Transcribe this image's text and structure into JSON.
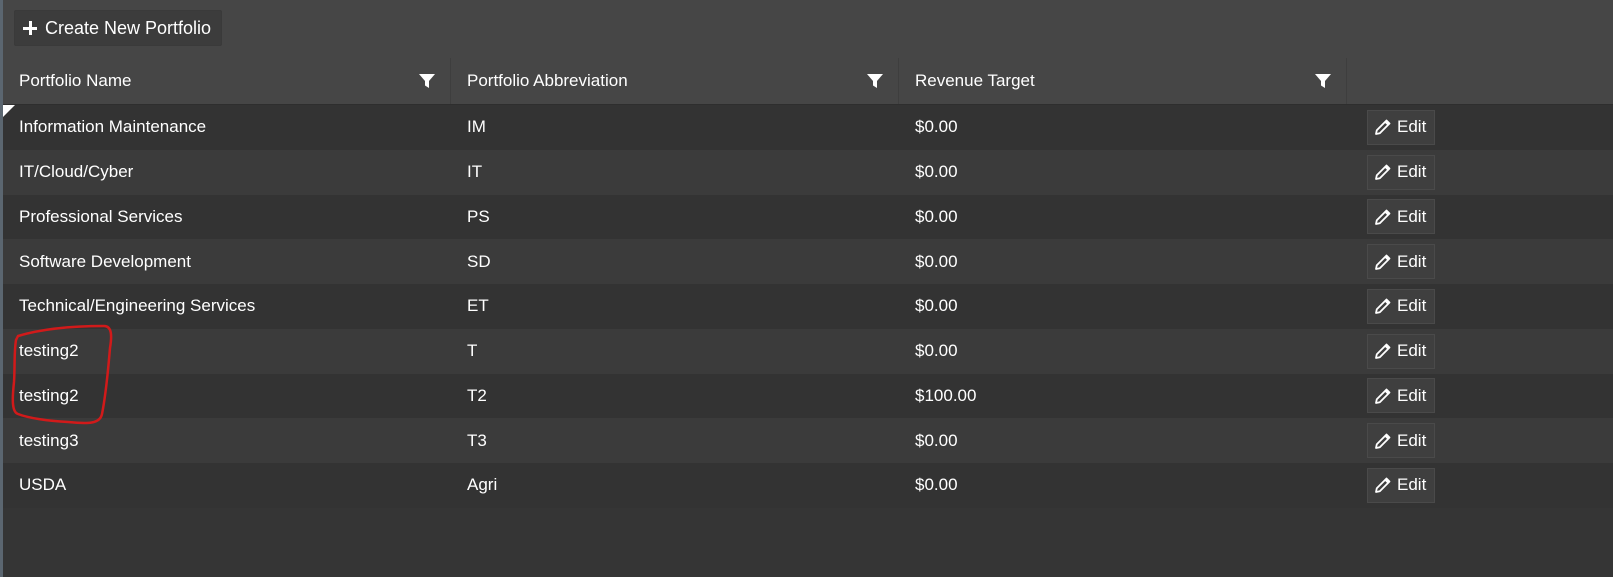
{
  "toolbar": {
    "create_label": "Create New Portfolio"
  },
  "columns": [
    {
      "label": "Portfolio Name",
      "filterable": true
    },
    {
      "label": "Portfolio Abbreviation",
      "filterable": true
    },
    {
      "label": "Revenue Target",
      "filterable": true
    },
    {
      "label": "",
      "filterable": false
    }
  ],
  "rows": [
    {
      "name": "Information Maintenance",
      "abbr": "IM",
      "revenue": "$0.00",
      "action": "Edit"
    },
    {
      "name": "IT/Cloud/Cyber",
      "abbr": "IT",
      "revenue": "$0.00",
      "action": "Edit"
    },
    {
      "name": "Professional Services",
      "abbr": "PS",
      "revenue": "$0.00",
      "action": "Edit"
    },
    {
      "name": "Software Development",
      "abbr": "SD",
      "revenue": "$0.00",
      "action": "Edit"
    },
    {
      "name": "Technical/Engineering Services",
      "abbr": "ET",
      "revenue": "$0.00",
      "action": "Edit"
    },
    {
      "name": "testing2",
      "abbr": "T",
      "revenue": "$0.00",
      "action": "Edit"
    },
    {
      "name": "testing2",
      "abbr": "T2",
      "revenue": "$100.00",
      "action": "Edit"
    },
    {
      "name": "testing3",
      "abbr": "T3",
      "revenue": "$0.00",
      "action": "Edit"
    },
    {
      "name": "USDA",
      "abbr": "Agri",
      "revenue": "$0.00",
      "action": "Edit"
    }
  ],
  "icons": {
    "create": "plus-icon",
    "filter": "filter-icon",
    "edit": "pencil-icon"
  },
  "colors": {
    "annotation": "#d11a1a",
    "background": "#353535",
    "header": "#464646"
  }
}
